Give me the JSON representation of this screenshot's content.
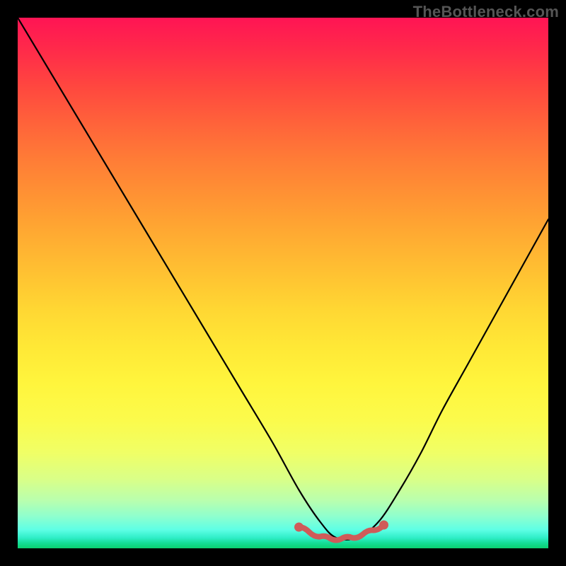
{
  "watermark": "TheBottleneck.com",
  "domain_note": "bottleneck-style V-curve over rainbow gradient",
  "colors": {
    "curve_stroke": "#000000",
    "marker_stroke": "#cf5b59",
    "marker_fill": "#cf5b59",
    "background": "#000000"
  },
  "chart_data": {
    "type": "line",
    "title": "",
    "xlabel": "",
    "ylabel": "",
    "xlim": [
      0,
      100
    ],
    "ylim": [
      0,
      100
    ],
    "grid": false,
    "legend": false,
    "series": [
      {
        "name": "curve",
        "x": [
          0,
          6,
          12,
          18,
          24,
          30,
          36,
          42,
          48,
          53,
          57,
          60,
          64,
          68,
          72,
          76,
          80,
          85,
          90,
          95,
          100
        ],
        "values": [
          100,
          90,
          80,
          70,
          60,
          50,
          40,
          30,
          20,
          11,
          5,
          2,
          2,
          5,
          11,
          18,
          26,
          35,
          44,
          53,
          62
        ]
      }
    ],
    "markers": {
      "name": "flat-bottom-highlight",
      "x": [
        53,
        55,
        57,
        59,
        61,
        63,
        65,
        67,
        69
      ],
      "values": [
        4.0,
        3.0,
        2.2,
        1.8,
        1.8,
        2.0,
        2.6,
        3.4,
        4.4
      ]
    }
  }
}
